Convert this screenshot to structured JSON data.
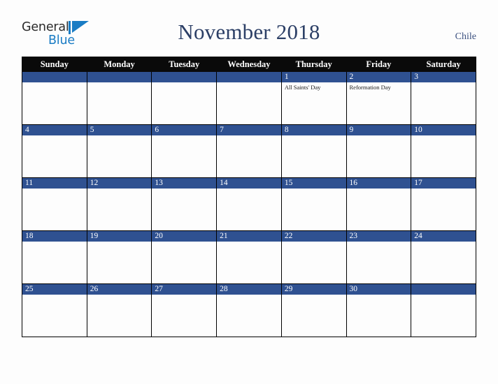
{
  "logo": {
    "word_one": "General",
    "word_two": "Blue",
    "mark": "triangle-flag-icon",
    "color_dark": "#2b2b2b",
    "color_blue": "#1a7cc4"
  },
  "header": {
    "title": "November 2018",
    "country": "Chile",
    "title_color": "#2c3f66"
  },
  "colors": {
    "header_row_bg": "#0a0a0a",
    "header_row_text": "#ffffff",
    "day_band_bg": "#2f5191",
    "day_band_text": "#ffffff",
    "cell_bg": "#fdfdfd",
    "grid_line": "#000000",
    "page_bg": "#fdfdfd"
  },
  "weekdays": [
    "Sunday",
    "Monday",
    "Tuesday",
    "Wednesday",
    "Thursday",
    "Friday",
    "Saturday"
  ],
  "weeks": [
    [
      {
        "day": "",
        "events": []
      },
      {
        "day": "",
        "events": []
      },
      {
        "day": "",
        "events": []
      },
      {
        "day": "",
        "events": []
      },
      {
        "day": "1",
        "events": [
          "All Saints' Day"
        ]
      },
      {
        "day": "2",
        "events": [
          "Reformation Day"
        ]
      },
      {
        "day": "3",
        "events": []
      }
    ],
    [
      {
        "day": "4",
        "events": []
      },
      {
        "day": "5",
        "events": []
      },
      {
        "day": "6",
        "events": []
      },
      {
        "day": "7",
        "events": []
      },
      {
        "day": "8",
        "events": []
      },
      {
        "day": "9",
        "events": []
      },
      {
        "day": "10",
        "events": []
      }
    ],
    [
      {
        "day": "11",
        "events": []
      },
      {
        "day": "12",
        "events": []
      },
      {
        "day": "13",
        "events": []
      },
      {
        "day": "14",
        "events": []
      },
      {
        "day": "15",
        "events": []
      },
      {
        "day": "16",
        "events": []
      },
      {
        "day": "17",
        "events": []
      }
    ],
    [
      {
        "day": "18",
        "events": []
      },
      {
        "day": "19",
        "events": []
      },
      {
        "day": "20",
        "events": []
      },
      {
        "day": "21",
        "events": []
      },
      {
        "day": "22",
        "events": []
      },
      {
        "day": "23",
        "events": []
      },
      {
        "day": "24",
        "events": []
      }
    ],
    [
      {
        "day": "25",
        "events": []
      },
      {
        "day": "26",
        "events": []
      },
      {
        "day": "27",
        "events": []
      },
      {
        "day": "28",
        "events": []
      },
      {
        "day": "29",
        "events": []
      },
      {
        "day": "30",
        "events": []
      },
      {
        "day": "",
        "events": []
      }
    ]
  ]
}
